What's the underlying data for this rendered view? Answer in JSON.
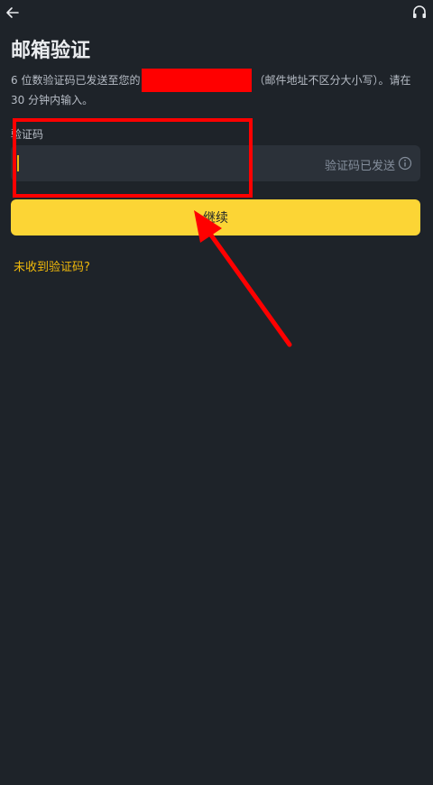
{
  "header": {
    "back_icon": "arrow-left-icon",
    "support_icon": "headset-icon"
  },
  "page": {
    "title": "邮箱验证",
    "description_before": "6 位数验证码已发送至您的",
    "description_after": "（邮件地址不区分大小写）。请在 30 分钟内输入。"
  },
  "form": {
    "code_label": "验证码",
    "code_value": "",
    "sent_status": "验证码已发送",
    "info_icon": "info-circle-icon",
    "continue_label": "继续",
    "resend_link": "未收到验证码?"
  },
  "colors": {
    "background": "#1e2329",
    "input_bg": "#2b3139",
    "accent": "#fcd535",
    "link": "#f0b90b",
    "annotation": "#ff0000"
  }
}
